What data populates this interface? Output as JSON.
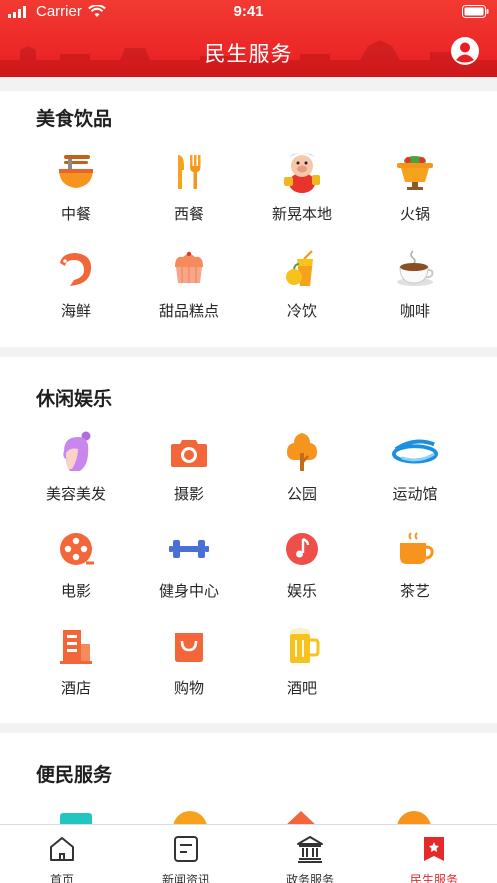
{
  "status_bar": {
    "carrier": "Carrier",
    "time": "9:41"
  },
  "header": {
    "title": "民生服务"
  },
  "sections": [
    {
      "title": "美食饮品",
      "items": [
        {
          "label": "中餐",
          "icon": "noodle-bowl-icon"
        },
        {
          "label": "西餐",
          "icon": "fork-knife-icon"
        },
        {
          "label": "新晃本地",
          "icon": "mascot-icon"
        },
        {
          "label": "火锅",
          "icon": "hotpot-icon"
        },
        {
          "label": "海鲜",
          "icon": "shrimp-icon"
        },
        {
          "label": "甜品糕点",
          "icon": "cake-icon"
        },
        {
          "label": "冷饮",
          "icon": "cold-drink-icon"
        },
        {
          "label": "咖啡",
          "icon": "coffee-icon"
        }
      ]
    },
    {
      "title": "休闲娱乐",
      "items": [
        {
          "label": "美容美发",
          "icon": "beauty-icon"
        },
        {
          "label": "摄影",
          "icon": "camera-icon"
        },
        {
          "label": "公园",
          "icon": "tree-icon"
        },
        {
          "label": "运动馆",
          "icon": "stadium-icon"
        },
        {
          "label": "电影",
          "icon": "film-reel-icon"
        },
        {
          "label": "健身中心",
          "icon": "dumbbell-icon"
        },
        {
          "label": "娱乐",
          "icon": "music-note-icon"
        },
        {
          "label": "茶艺",
          "icon": "tea-cup-icon"
        },
        {
          "label": "酒店",
          "icon": "hotel-icon"
        },
        {
          "label": "购物",
          "icon": "shopping-bag-icon"
        },
        {
          "label": "酒吧",
          "icon": "beer-icon"
        }
      ]
    },
    {
      "title": "便民服务",
      "items": []
    }
  ],
  "tabbar": [
    {
      "label": "首页",
      "icon": "home-icon",
      "active": false
    },
    {
      "label": "新闻资讯",
      "icon": "news-icon",
      "active": false
    },
    {
      "label": "政务服务",
      "icon": "government-icon",
      "active": false
    },
    {
      "label": "民生服务",
      "icon": "livelihood-icon",
      "active": true
    }
  ],
  "colors": {
    "brand": "#e81e22",
    "active_tab": "#e52a2a",
    "icon_orange": "#f7941d"
  }
}
